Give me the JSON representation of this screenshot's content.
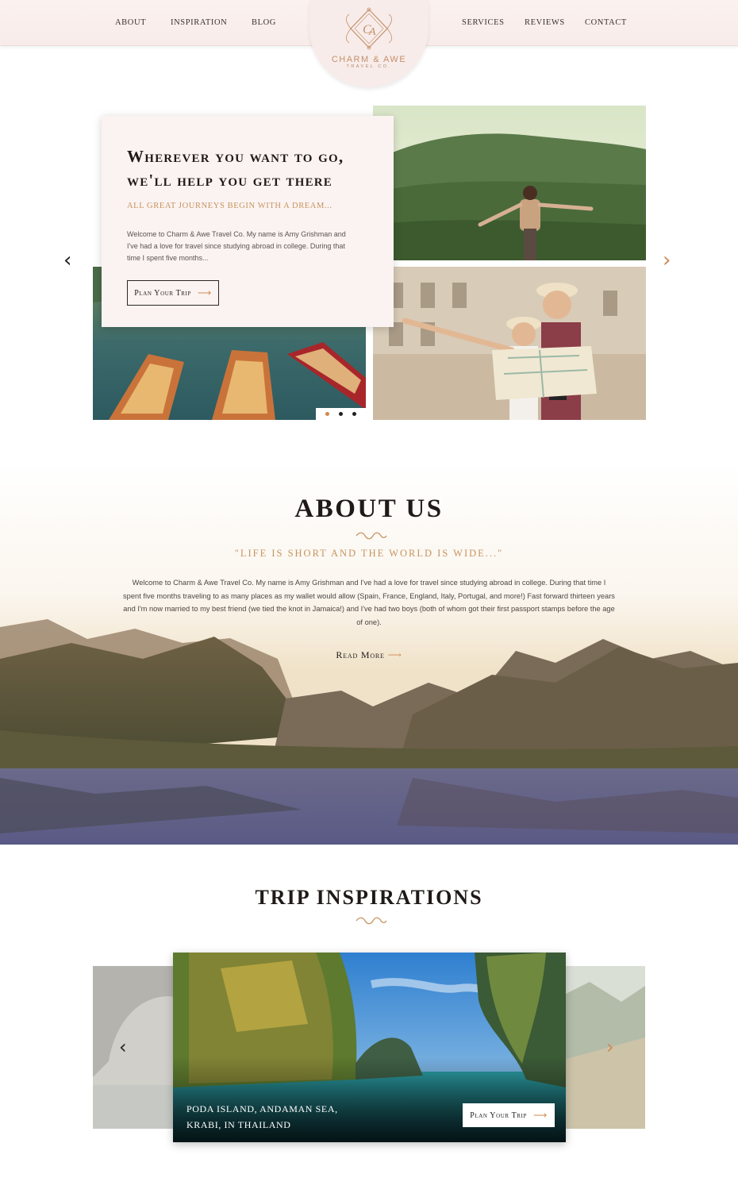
{
  "nav": {
    "left": [
      "ABOUT",
      "INSPIRATION",
      "BLOG"
    ],
    "right": [
      "SERVICES",
      "REVIEWS",
      "CONTACT"
    ]
  },
  "logo": {
    "name": "CHARM & AWE",
    "subtitle": "TRAVEL CO."
  },
  "hero": {
    "title": "Wherever you want to go, we'll help you get there",
    "tagline": "All great journeys begin with a dream...",
    "body": "Welcome to Charm & Awe Travel Co. My name is Amy Grishman and I've had a love for travel since studying abroad in college. During that time I spent five months...",
    "cta": "Plan Your Trip",
    "prev_icon": "‹",
    "next_icon": "›",
    "slides": 3,
    "active_slide": 1
  },
  "about": {
    "title": "ABOUT US",
    "quote": "\"Life is short and the world is wide...\"",
    "body": "Welcome to Charm & Awe Travel Co. My name is Amy Grishman and I've had a love for travel since studying abroad in college. During that time I spent five months traveling to as many places as my wallet would allow (Spain, France, England, Italy, Portugal, and more!) Fast forward thirteen years and I'm now married to my best friend (we tied the knot in Jamaica!) and I've had two boys (both of whom got their first passport stamps before the age of one).",
    "read_more": "Read More"
  },
  "trips": {
    "title": "TRIP INSPIRATIONS",
    "caption": "PODA ISLAND, ANDAMAN SEA,\nKRABI, IN THAILAND",
    "cta": "Plan Your Trip"
  },
  "colors": {
    "accent": "#c7935f",
    "nav_bg": "#f8ecea",
    "card_bg": "#fbf3f1",
    "text": "#1f1a18"
  }
}
